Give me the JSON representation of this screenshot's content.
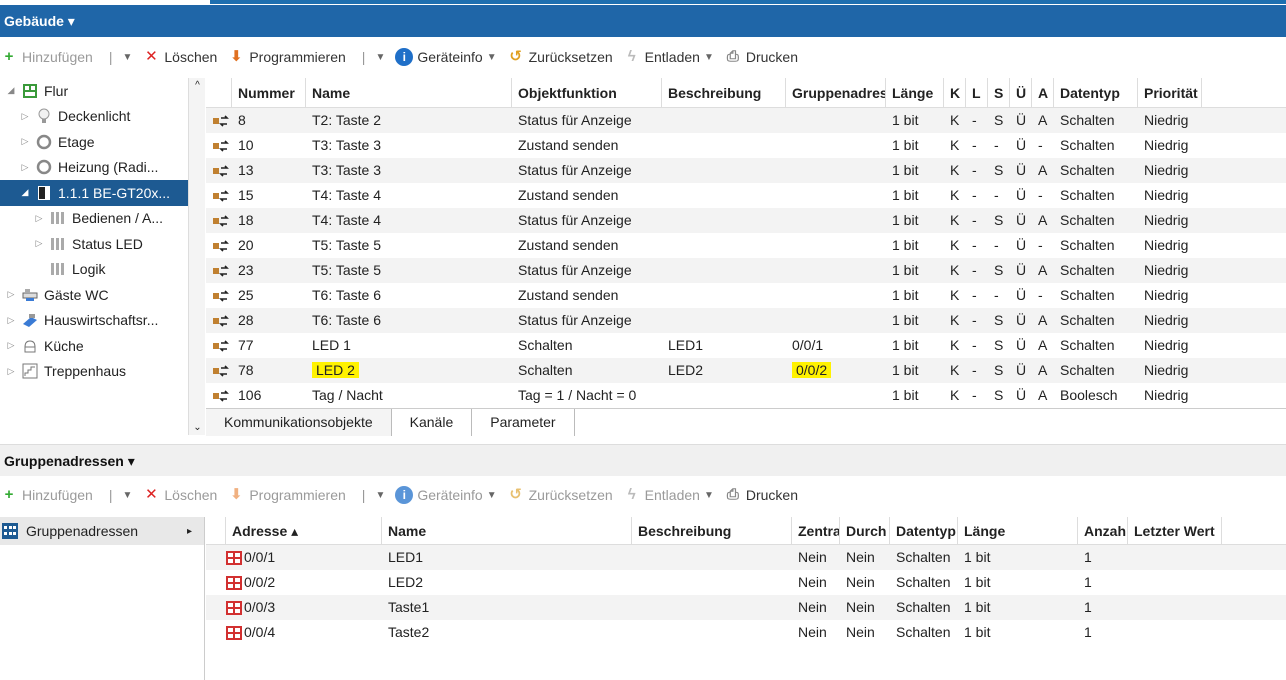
{
  "colors": {
    "panel_blue": "#1f66a8",
    "selection": "#1d5a92",
    "highlight": "#fff200",
    "danger": "#d22",
    "add": "#3a3",
    "info": "#1f6fc8"
  },
  "buildings_panel": {
    "title": "Gebäude ▾"
  },
  "toolbar_top": {
    "add": "Hinzufügen",
    "delete": "Löschen",
    "program": "Programmieren",
    "device_info": "Geräteinfo",
    "reset": "Zurücksetzen",
    "unload": "Entladen",
    "print": "Drucken"
  },
  "tree": {
    "items": [
      {
        "label": "Flur",
        "icon": "floor-icon"
      },
      {
        "label": "Deckenlicht",
        "icon": "bulb-icon"
      },
      {
        "label": "Etage",
        "icon": "ring-icon"
      },
      {
        "label": "Heizung (Radi...",
        "icon": "ring-icon"
      },
      {
        "label": "1.1.1 BE-GT20x...",
        "icon": "device-icon"
      },
      {
        "label": "Bedienen / A...",
        "icon": "channel-icon"
      },
      {
        "label": "Status LED",
        "icon": "channel-icon"
      },
      {
        "label": "Logik",
        "icon": "channel-icon"
      },
      {
        "label": "Gäste WC",
        "icon": "wc-icon"
      },
      {
        "label": "Hauswirtschaftsr...",
        "icon": "room-icon"
      },
      {
        "label": "Küche",
        "icon": "kitchen-icon"
      },
      {
        "label": "Treppenhaus",
        "icon": "stairs-icon"
      }
    ]
  },
  "objects_table": {
    "headers": [
      "Nummer",
      "Name",
      "Objektfunktion",
      "Beschreibung",
      "Gruppenadres",
      "Länge",
      "K",
      "L",
      "S",
      "Ü",
      "A",
      "Datentyp",
      "Priorität"
    ],
    "rows": [
      [
        "8",
        "T2: Taste 2",
        "Status für Anzeige",
        "",
        "",
        "1 bit",
        "K",
        "-",
        "S",
        "Ü",
        "A",
        "Schalten",
        "Niedrig"
      ],
      [
        "10",
        "T3: Taste 3",
        "Zustand senden",
        "",
        "",
        "1 bit",
        "K",
        "-",
        "-",
        "Ü",
        "-",
        "Schalten",
        "Niedrig"
      ],
      [
        "13",
        "T3: Taste 3",
        "Status für Anzeige",
        "",
        "",
        "1 bit",
        "K",
        "-",
        "S",
        "Ü",
        "A",
        "Schalten",
        "Niedrig"
      ],
      [
        "15",
        "T4: Taste 4",
        "Zustand senden",
        "",
        "",
        "1 bit",
        "K",
        "-",
        "-",
        "Ü",
        "-",
        "Schalten",
        "Niedrig"
      ],
      [
        "18",
        "T4: Taste 4",
        "Status für Anzeige",
        "",
        "",
        "1 bit",
        "K",
        "-",
        "S",
        "Ü",
        "A",
        "Schalten",
        "Niedrig"
      ],
      [
        "20",
        "T5: Taste 5",
        "Zustand senden",
        "",
        "",
        "1 bit",
        "K",
        "-",
        "-",
        "Ü",
        "-",
        "Schalten",
        "Niedrig"
      ],
      [
        "23",
        "T5: Taste 5",
        "Status für Anzeige",
        "",
        "",
        "1 bit",
        "K",
        "-",
        "S",
        "Ü",
        "A",
        "Schalten",
        "Niedrig"
      ],
      [
        "25",
        "T6: Taste 6",
        "Zustand senden",
        "",
        "",
        "1 bit",
        "K",
        "-",
        "-",
        "Ü",
        "-",
        "Schalten",
        "Niedrig"
      ],
      [
        "28",
        "T6: Taste 6",
        "Status für Anzeige",
        "",
        "",
        "1 bit",
        "K",
        "-",
        "S",
        "Ü",
        "A",
        "Schalten",
        "Niedrig"
      ],
      [
        "77",
        "LED 1",
        "Schalten",
        "LED1",
        "0/0/1",
        "1 bit",
        "K",
        "-",
        "S",
        "Ü",
        "A",
        "Schalten",
        "Niedrig"
      ],
      [
        "78",
        "LED 2",
        "Schalten",
        "LED2",
        "0/0/2",
        "1 bit",
        "K",
        "-",
        "S",
        "Ü",
        "A",
        "Schalten",
        "Niedrig"
      ],
      [
        "106",
        "Tag / Nacht",
        "Tag = 1 / Nacht = 0",
        "",
        "",
        "1 bit",
        "K",
        "-",
        "S",
        "Ü",
        "A",
        "Boolesch",
        "Niedrig"
      ]
    ]
  },
  "tabs": [
    "Kommunikationsobjekte",
    "Kanäle",
    "Parameter"
  ],
  "group_panel": {
    "title": "Gruppenadressen ▾"
  },
  "toolbar_bottom": {
    "add": "Hinzufügen",
    "delete": "Löschen",
    "program": "Programmieren",
    "device_info": "Geräteinfo",
    "reset": "Zurücksetzen",
    "unload": "Entladen",
    "print": "Drucken"
  },
  "group_tree": {
    "label": "Gruppenadressen"
  },
  "group_table": {
    "headers": [
      "Adresse ▴",
      "Name",
      "Beschreibung",
      "Zentra",
      "Durch",
      "Datentyp",
      "Länge",
      "Anzah",
      "Letzter Wert"
    ],
    "rows": [
      [
        "0/0/1",
        "LED1",
        "",
        "Nein",
        "Nein",
        "Schalten",
        "1 bit",
        "1",
        ""
      ],
      [
        "0/0/2",
        "LED2",
        "",
        "Nein",
        "Nein",
        "Schalten",
        "1 bit",
        "1",
        ""
      ],
      [
        "0/0/3",
        "Taste1",
        "",
        "Nein",
        "Nein",
        "Schalten",
        "1 bit",
        "1",
        ""
      ],
      [
        "0/0/4",
        "Taste2",
        "",
        "Nein",
        "Nein",
        "Schalten",
        "1 bit",
        "1",
        ""
      ]
    ]
  }
}
